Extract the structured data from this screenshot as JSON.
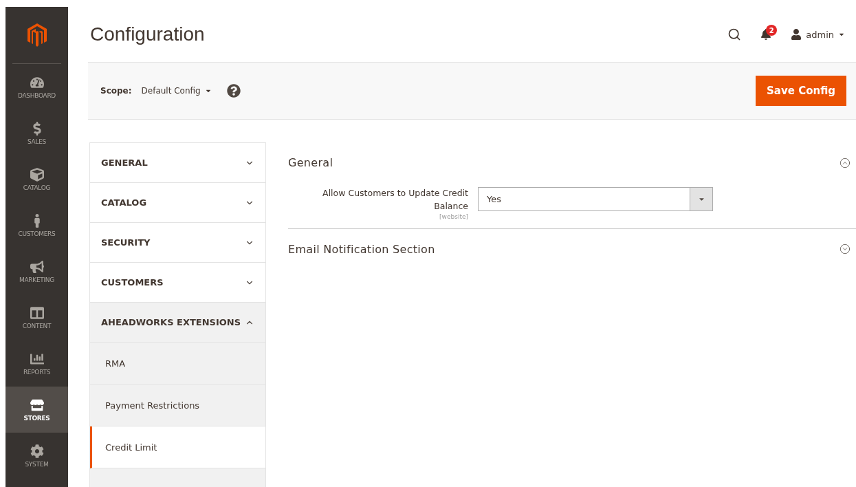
{
  "sidebar": {
    "items": [
      {
        "label": "DASHBOARD",
        "selected": false
      },
      {
        "label": "SALES",
        "selected": false
      },
      {
        "label": "CATALOG",
        "selected": false
      },
      {
        "label": "CUSTOMERS",
        "selected": false
      },
      {
        "label": "MARKETING",
        "selected": false
      },
      {
        "label": "CONTENT",
        "selected": false
      },
      {
        "label": "REPORTS",
        "selected": false
      },
      {
        "label": "STORES",
        "selected": true
      },
      {
        "label": "SYSTEM",
        "selected": false
      }
    ]
  },
  "header": {
    "title": "Configuration",
    "notifications": "2",
    "user": "admin"
  },
  "scope_bar": {
    "label": "Scope:",
    "value": "Default Config",
    "save_button": "Save Config"
  },
  "config_nav": [
    {
      "label": "GENERAL",
      "expanded": false
    },
    {
      "label": "CATALOG",
      "expanded": false
    },
    {
      "label": "SECURITY",
      "expanded": false
    },
    {
      "label": "CUSTOMERS",
      "expanded": false
    },
    {
      "label": "AHEADWORKS EXTENSIONS",
      "expanded": true,
      "children": [
        {
          "label": "RMA",
          "selected": false
        },
        {
          "label": "Payment Restrictions",
          "selected": false
        },
        {
          "label": "Credit Limit",
          "selected": true
        }
      ]
    }
  ],
  "sections": [
    {
      "title": "General",
      "expanded": true,
      "fields": [
        {
          "label": "Allow Customers to Update Credit Balance",
          "scope": "[website]",
          "value": "Yes"
        }
      ]
    },
    {
      "title": "Email Notification Section",
      "expanded": false
    }
  ]
}
